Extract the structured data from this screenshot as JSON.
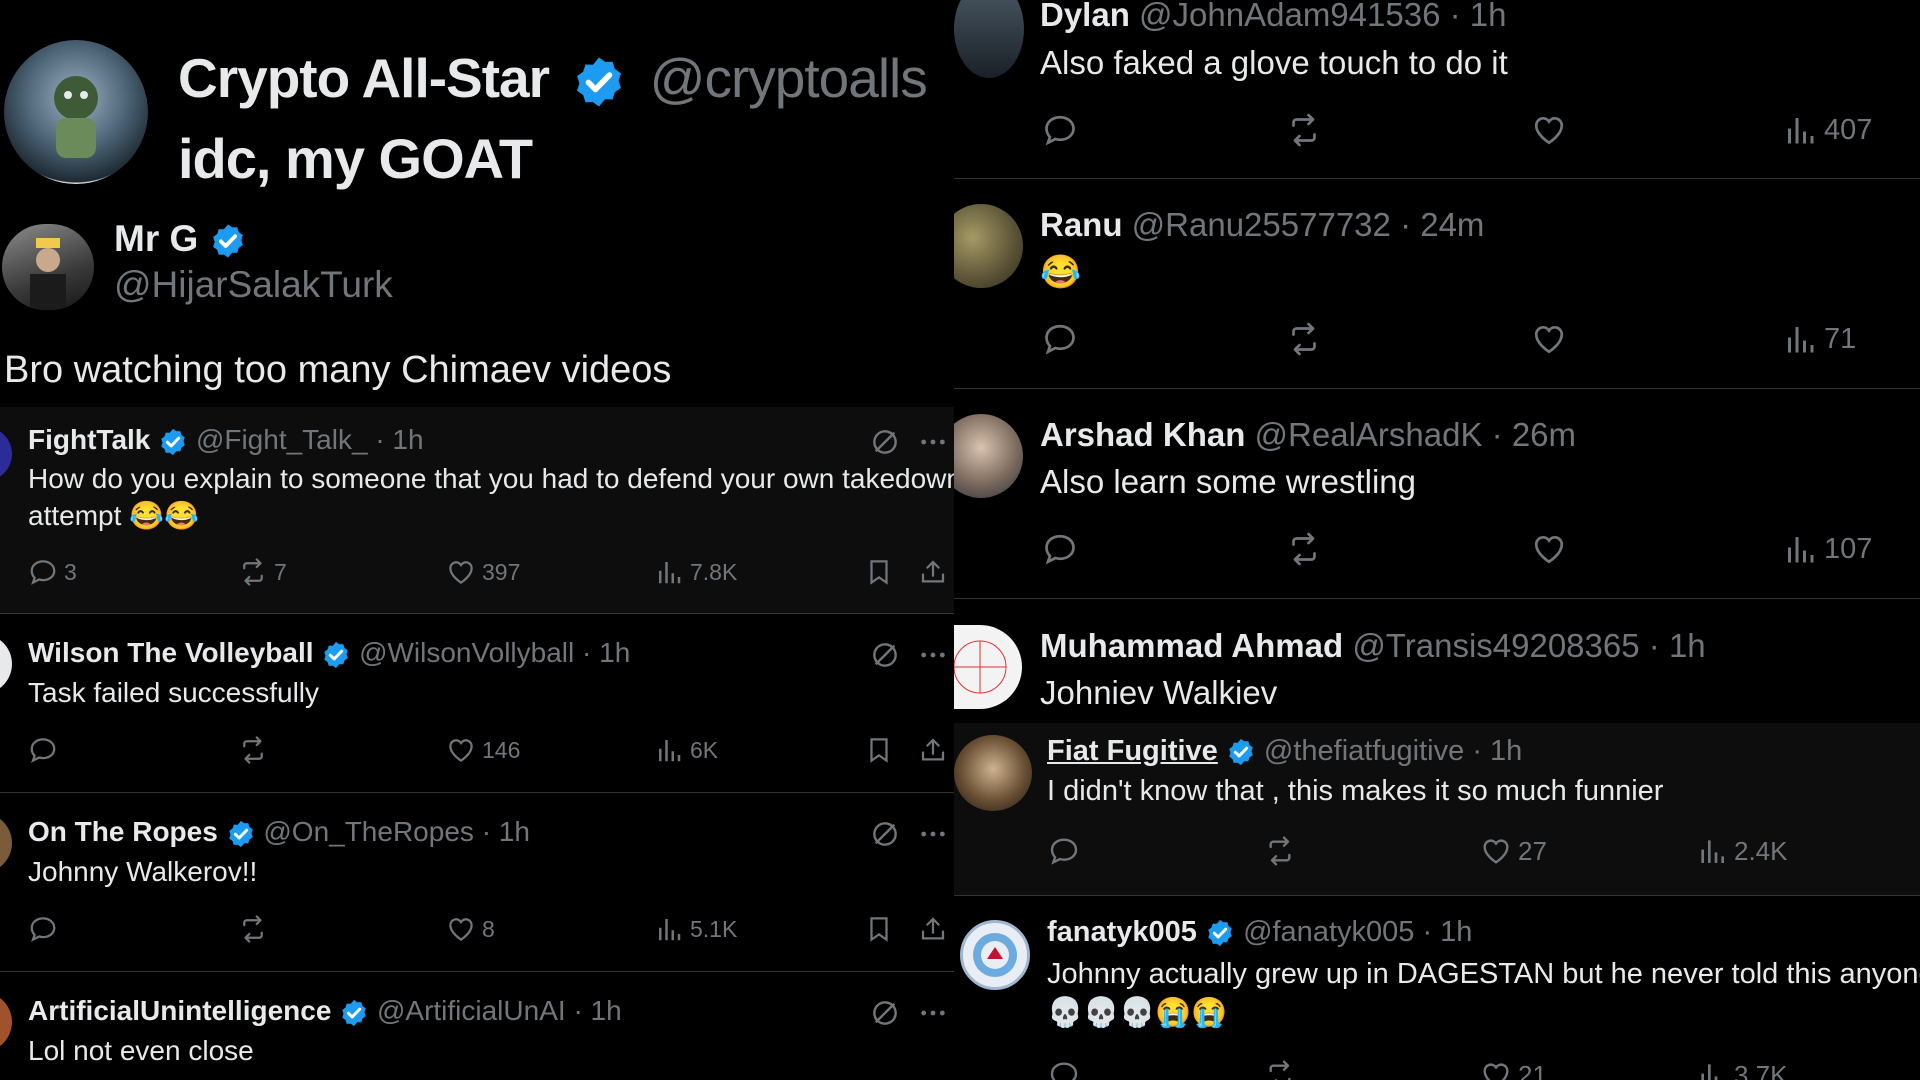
{
  "left": {
    "big_quote": {
      "name": "Crypto All-Star",
      "handle": "@cryptoalls",
      "text": "idc, my GOAT"
    },
    "main_post": {
      "name": "Mr G",
      "handle": "@HijarSalakTurk",
      "text": "Bro watching too many Chimaev videos"
    },
    "replies": [
      {
        "name": "FightTalk",
        "handle": "@Fight_Talk_",
        "time": "· 1h",
        "text_line1": "How do you explain to someone that you had to defend your own takedown",
        "text_line2": "attempt 😂😂",
        "replies": "3",
        "reposts": "7",
        "likes": "397",
        "views": "7.8K"
      },
      {
        "name": "Wilson The Volleyball",
        "handle": "@WilsonVollyball",
        "time": "· 1h",
        "text_line1": "Task failed successfully",
        "text_line2": "",
        "replies": "",
        "reposts": "",
        "likes": "146",
        "views": "6K"
      },
      {
        "name": "On The Ropes",
        "handle": "@On_TheRopes",
        "time": "· 1h",
        "text_line1": "Johnny Walkerov!!",
        "text_line2": "",
        "replies": "",
        "reposts": "",
        "likes": "8",
        "views": "5.1K"
      },
      {
        "name": "ArtificialUnintelligence",
        "handle": "@ArtificialUnAI",
        "time": "· 1h",
        "text_line1": "Lol not even close",
        "text_line2": "",
        "replies": "",
        "reposts": "",
        "likes": "",
        "views": ""
      }
    ]
  },
  "right": {
    "replies": [
      {
        "name": "Dylan",
        "handle": "@JohnAdam941536",
        "time": "· 1h",
        "text": "Also faked a glove touch to do it",
        "views": "407"
      },
      {
        "name": "Ranu",
        "handle": "@Ranu25577732",
        "time": "· 24m",
        "text": "😂",
        "views": "71"
      },
      {
        "name": "Arshad Khan",
        "handle": "@RealArshadK",
        "time": "· 26m",
        "text": "Also learn some wrestling",
        "views": "107"
      },
      {
        "name": "Muhammad Ahmad",
        "handle": "@Transis49208365",
        "time": "· 1h",
        "text": "Johniev Walkiev",
        "views": ""
      }
    ],
    "fiat": {
      "name": "Fiat Fugitive",
      "handle": "@thefiatfugitive",
      "time": "· 1h",
      "text": "I didn't know that , this makes it so much funnier",
      "likes": "27",
      "views": "2.4K"
    },
    "fanatyk": {
      "name": "fanatyk005",
      "handle": "@fanatyk005",
      "time": "· 1h",
      "text_line1": "Johnny actually grew up in DAGESTAN but he never told this anyone",
      "text_line2": "💀💀💀😭😭",
      "likes": "21",
      "views": "3.7K"
    }
  },
  "colors": {
    "verified": "#1d9bf0",
    "background": "#000000",
    "muted": "#71767b",
    "text": "#e7e9ea"
  }
}
